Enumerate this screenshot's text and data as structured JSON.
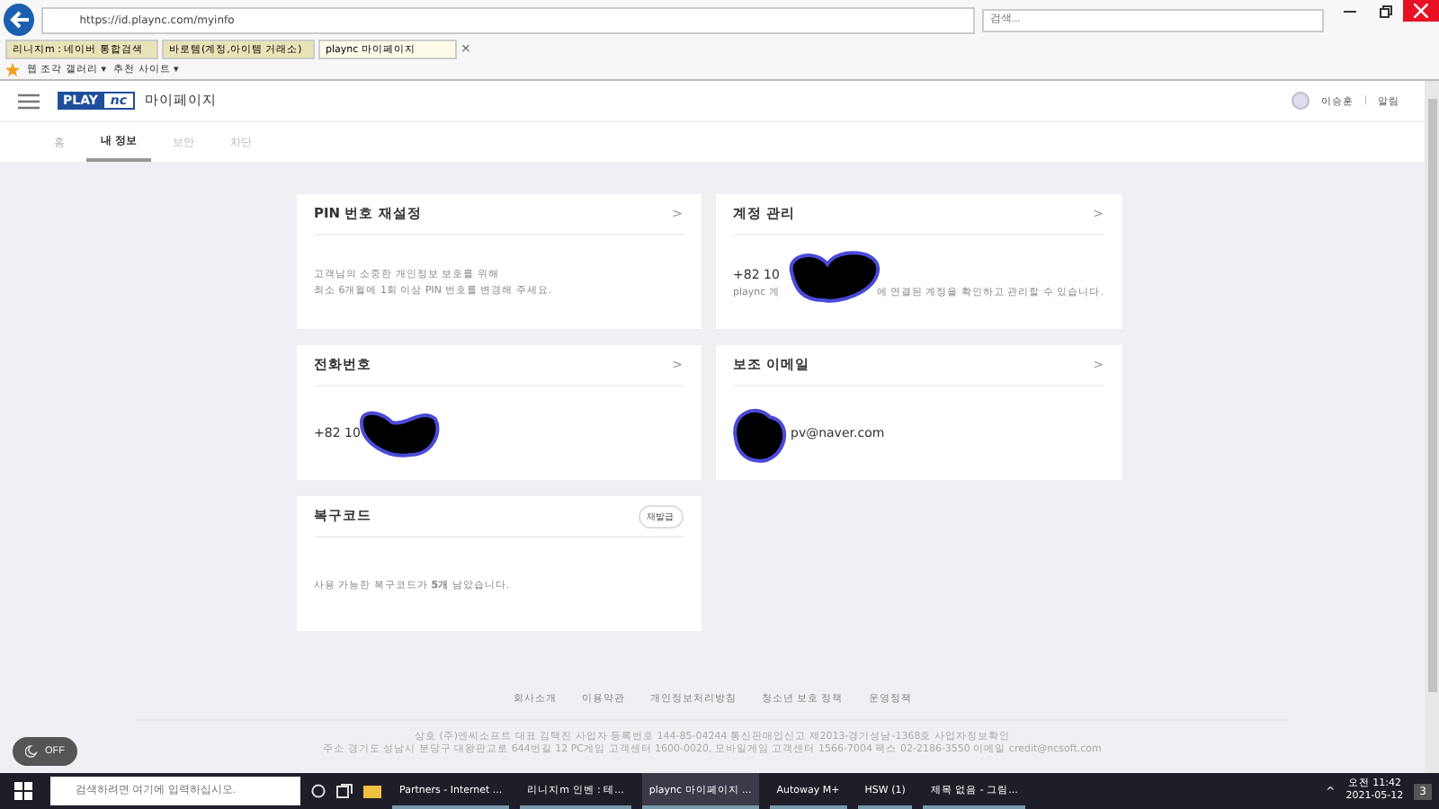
{
  "browser": {
    "url": "https://id.plaync.com/myinfo",
    "search_placeholder": "검색...",
    "tabs": [
      {
        "label": "리니지m : 네이버 통합검색",
        "selected": false
      },
      {
        "label": "바로템(계정,아이템 거래소)",
        "selected": false
      },
      {
        "label": "plaync 마이페이지",
        "selected": true
      }
    ],
    "close_tab": "×",
    "favorites": [
      "웹 조각 갤러리 ▾",
      "추천 사이트 ▾"
    ]
  },
  "header": {
    "logo_left": "PLAY",
    "logo_right": "nc",
    "title": "마이페이지",
    "user": "이승훈",
    "separator": "|",
    "alarm": "알림"
  },
  "nav": [
    {
      "label": "홈",
      "selected": false
    },
    {
      "label": "내 정보",
      "selected": true
    },
    {
      "label": "보안",
      "selected": false
    },
    {
      "label": "차단",
      "selected": false
    }
  ],
  "cards": [
    {
      "kind": "text",
      "title": "PIN 번호 재설정",
      "chevron": ">",
      "lines": [
        "고객님의 소중한 개인정보 보호를 위해",
        "최소 6개월에 1회 이상 PIN 번호를 변경해 주세요."
      ]
    },
    {
      "kind": "account",
      "title": "계정 관리",
      "chevron": ">",
      "value": "+82 10",
      "desc_start": "plaync 계",
      "desc_end": "에 연결된 계정을 확인하고 관리할 수 있습니다."
    },
    {
      "kind": "value",
      "title": "전화번호",
      "chevron": ">",
      "value": "+82 10"
    },
    {
      "kind": "email",
      "title": "보조 이메일",
      "chevron": ">",
      "value": "pv@naver.com"
    },
    {
      "kind": "recovery",
      "title": "복구코드",
      "button": "재발급",
      "line": "사용 가능한 복구코드가 **5개** 남았습니다."
    }
  ],
  "footer": {
    "links": [
      "회사소개",
      "이용약관",
      "개인정보처리방침",
      "청소년 보호 정책",
      "운영정책"
    ],
    "info": [
      "상호 (주)엔씨소프트 대표 김택진 사업자 등록번호 144-85-04244 통신판매업신고 제2013-경기성남-1368호 사업자정보확인",
      "주소 경기도 성남시 분당구 대왕판교로 644번길 12 PC게임 고객센터 1600-0020, 모바일게임 고객센터 1566-7004 팩스 02-2186-3550 이메일 credit@ncsoft.com"
    ]
  },
  "night_toggle": {
    "label": "OFF",
    "on": false
  },
  "taskbar": {
    "search_placeholder": "검색하려면 여기에 입력하십시오.",
    "apps": [
      {
        "label": "Partners - Internet ...",
        "selected": false
      },
      {
        "label": "리니지m 인벤 : 테...",
        "selected": false
      },
      {
        "label": "plaync 마이페이지 ...",
        "selected": true
      },
      {
        "label": "Autoway M+",
        "selected": false
      },
      {
        "label": "HSW (1)",
        "selected": false
      },
      {
        "label": "제목 없음 - 그림...",
        "selected": false
      }
    ],
    "tray_caret": "^",
    "time": "오전 11:42",
    "date": "2021-05-12",
    "notifications": "3"
  }
}
